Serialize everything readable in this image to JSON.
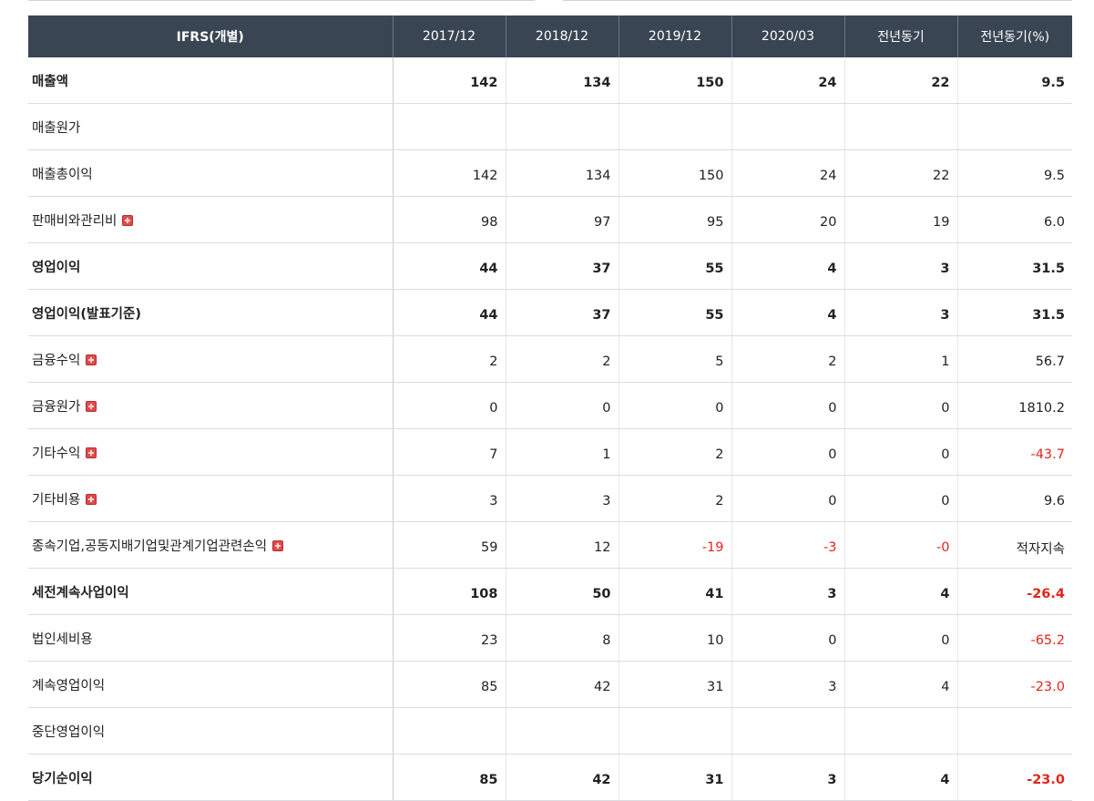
{
  "table": {
    "headers": [
      "IFRS(개별)",
      "2017/12",
      "2018/12",
      "2019/12",
      "2020/03",
      "전년동기",
      "전년동기(%)"
    ],
    "rows": [
      {
        "label": "매출액",
        "bold": true,
        "expandable": false,
        "values": [
          "142",
          "134",
          "150",
          "24",
          "22",
          "9.5"
        ]
      },
      {
        "label": "매출원가",
        "bold": false,
        "expandable": false,
        "values": [
          "",
          "",
          "",
          "",
          "",
          ""
        ]
      },
      {
        "label": "매출총이익",
        "bold": false,
        "expandable": false,
        "values": [
          "142",
          "134",
          "150",
          "24",
          "22",
          "9.5"
        ]
      },
      {
        "label": "판매비와관리비",
        "bold": false,
        "expandable": true,
        "values": [
          "98",
          "97",
          "95",
          "20",
          "19",
          "6.0"
        ]
      },
      {
        "label": "영업이익",
        "bold": true,
        "expandable": false,
        "values": [
          "44",
          "37",
          "55",
          "4",
          "3",
          "31.5"
        ]
      },
      {
        "label": "영업이익(발표기준)",
        "bold": true,
        "expandable": false,
        "values": [
          "44",
          "37",
          "55",
          "4",
          "3",
          "31.5"
        ]
      },
      {
        "label": "금융수익",
        "bold": false,
        "expandable": true,
        "values": [
          "2",
          "2",
          "5",
          "2",
          "1",
          "56.7"
        ]
      },
      {
        "label": "금융원가",
        "bold": false,
        "expandable": true,
        "values": [
          "0",
          "0",
          "0",
          "0",
          "0",
          "1810.2"
        ]
      },
      {
        "label": "기타수익",
        "bold": false,
        "expandable": true,
        "values": [
          "7",
          "1",
          "2",
          "0",
          "0",
          "-43.7"
        ]
      },
      {
        "label": "기타비용",
        "bold": false,
        "expandable": true,
        "values": [
          "3",
          "3",
          "2",
          "0",
          "0",
          "9.6"
        ]
      },
      {
        "label": "종속기업,공동지배기업및관계기업관련손익",
        "bold": false,
        "expandable": true,
        "values": [
          "59",
          "12",
          "-19",
          "-3",
          "-0",
          "적자지속"
        ]
      },
      {
        "label": "세전계속사업이익",
        "bold": true,
        "expandable": false,
        "values": [
          "108",
          "50",
          "41",
          "3",
          "4",
          "-26.4"
        ]
      },
      {
        "label": "법인세비용",
        "bold": false,
        "expandable": false,
        "values": [
          "23",
          "8",
          "10",
          "0",
          "0",
          "-65.2"
        ]
      },
      {
        "label": "계속영업이익",
        "bold": false,
        "expandable": false,
        "values": [
          "85",
          "42",
          "31",
          "3",
          "4",
          "-23.0"
        ]
      },
      {
        "label": "중단영업이익",
        "bold": false,
        "expandable": false,
        "values": [
          "",
          "",
          "",
          "",
          "",
          ""
        ]
      },
      {
        "label": "당기순이익",
        "bold": true,
        "expandable": false,
        "values": [
          "85",
          "42",
          "31",
          "3",
          "4",
          "-23.0"
        ]
      }
    ]
  },
  "colors": {
    "header_bg": "#3a4553",
    "negative": "#e1261c",
    "expand_icon": "#e24b4b"
  },
  "icons": {
    "expand": "plus-icon"
  }
}
